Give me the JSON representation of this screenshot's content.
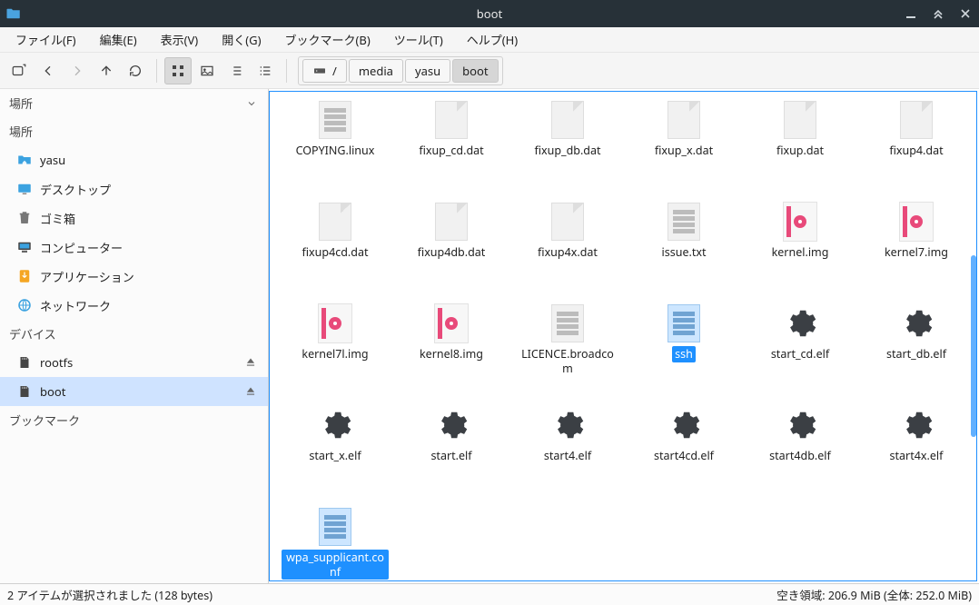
{
  "window": {
    "title": "boot"
  },
  "menubar": {
    "file": "ファイル(F)",
    "edit": "編集(E)",
    "view": "表示(V)",
    "go": "開く(G)",
    "bookmarks": "ブックマーク(B)",
    "tools": "ツール(T)",
    "help": "ヘルプ(H)"
  },
  "breadcrumbs": {
    "root": "/",
    "seg0": "media",
    "seg1": "yasu",
    "seg2": "boot"
  },
  "sidebar": {
    "sec_places": "場所",
    "sec_places2": "場所",
    "sec_devices": "デバイス",
    "sec_bookmarks": "ブックマーク",
    "items": {
      "home": "yasu",
      "desktop": "デスクトップ",
      "trash": "ゴミ箱",
      "computer": "コンピューター",
      "applications": "アプリケーション",
      "network": "ネットワーク",
      "rootfs": "rootfs",
      "boot": "boot"
    }
  },
  "files": [
    {
      "name": "COPYING.linux",
      "icon": "text",
      "selected": false
    },
    {
      "name": "fixup_cd.dat",
      "icon": "generic",
      "selected": false
    },
    {
      "name": "fixup_db.dat",
      "icon": "generic",
      "selected": false
    },
    {
      "name": "fixup_x.dat",
      "icon": "generic",
      "selected": false
    },
    {
      "name": "fixup.dat",
      "icon": "generic",
      "selected": false
    },
    {
      "name": "fixup4.dat",
      "icon": "generic",
      "selected": false
    },
    {
      "name": "fixup4cd.dat",
      "icon": "generic",
      "selected": false
    },
    {
      "name": "fixup4db.dat",
      "icon": "generic",
      "selected": false
    },
    {
      "name": "fixup4x.dat",
      "icon": "generic",
      "selected": false
    },
    {
      "name": "issue.txt",
      "icon": "text",
      "selected": false
    },
    {
      "name": "kernel.img",
      "icon": "img",
      "selected": false
    },
    {
      "name": "kernel7.img",
      "icon": "img",
      "selected": false
    },
    {
      "name": "kernel7l.img",
      "icon": "img",
      "selected": false
    },
    {
      "name": "kernel8.img",
      "icon": "img",
      "selected": false
    },
    {
      "name": "LICENCE.broadcom",
      "icon": "text",
      "selected": false
    },
    {
      "name": "ssh",
      "icon": "textsel",
      "selected": true
    },
    {
      "name": "start_cd.elf",
      "icon": "gear",
      "selected": false
    },
    {
      "name": "start_db.elf",
      "icon": "gear",
      "selected": false
    },
    {
      "name": "start_x.elf",
      "icon": "gear",
      "selected": false
    },
    {
      "name": "start.elf",
      "icon": "gear",
      "selected": false
    },
    {
      "name": "start4.elf",
      "icon": "gear",
      "selected": false
    },
    {
      "name": "start4cd.elf",
      "icon": "gear",
      "selected": false
    },
    {
      "name": "start4db.elf",
      "icon": "gear",
      "selected": false
    },
    {
      "name": "start4x.elf",
      "icon": "gear",
      "selected": false
    },
    {
      "name": "wpa_supplicant.conf",
      "icon": "textsel",
      "selected": true
    }
  ],
  "statusbar": {
    "left": "2 アイテムが選択されました (128 bytes)",
    "right": "空き領域: 206.9 MiB (全体: 252.0 MiB)"
  }
}
